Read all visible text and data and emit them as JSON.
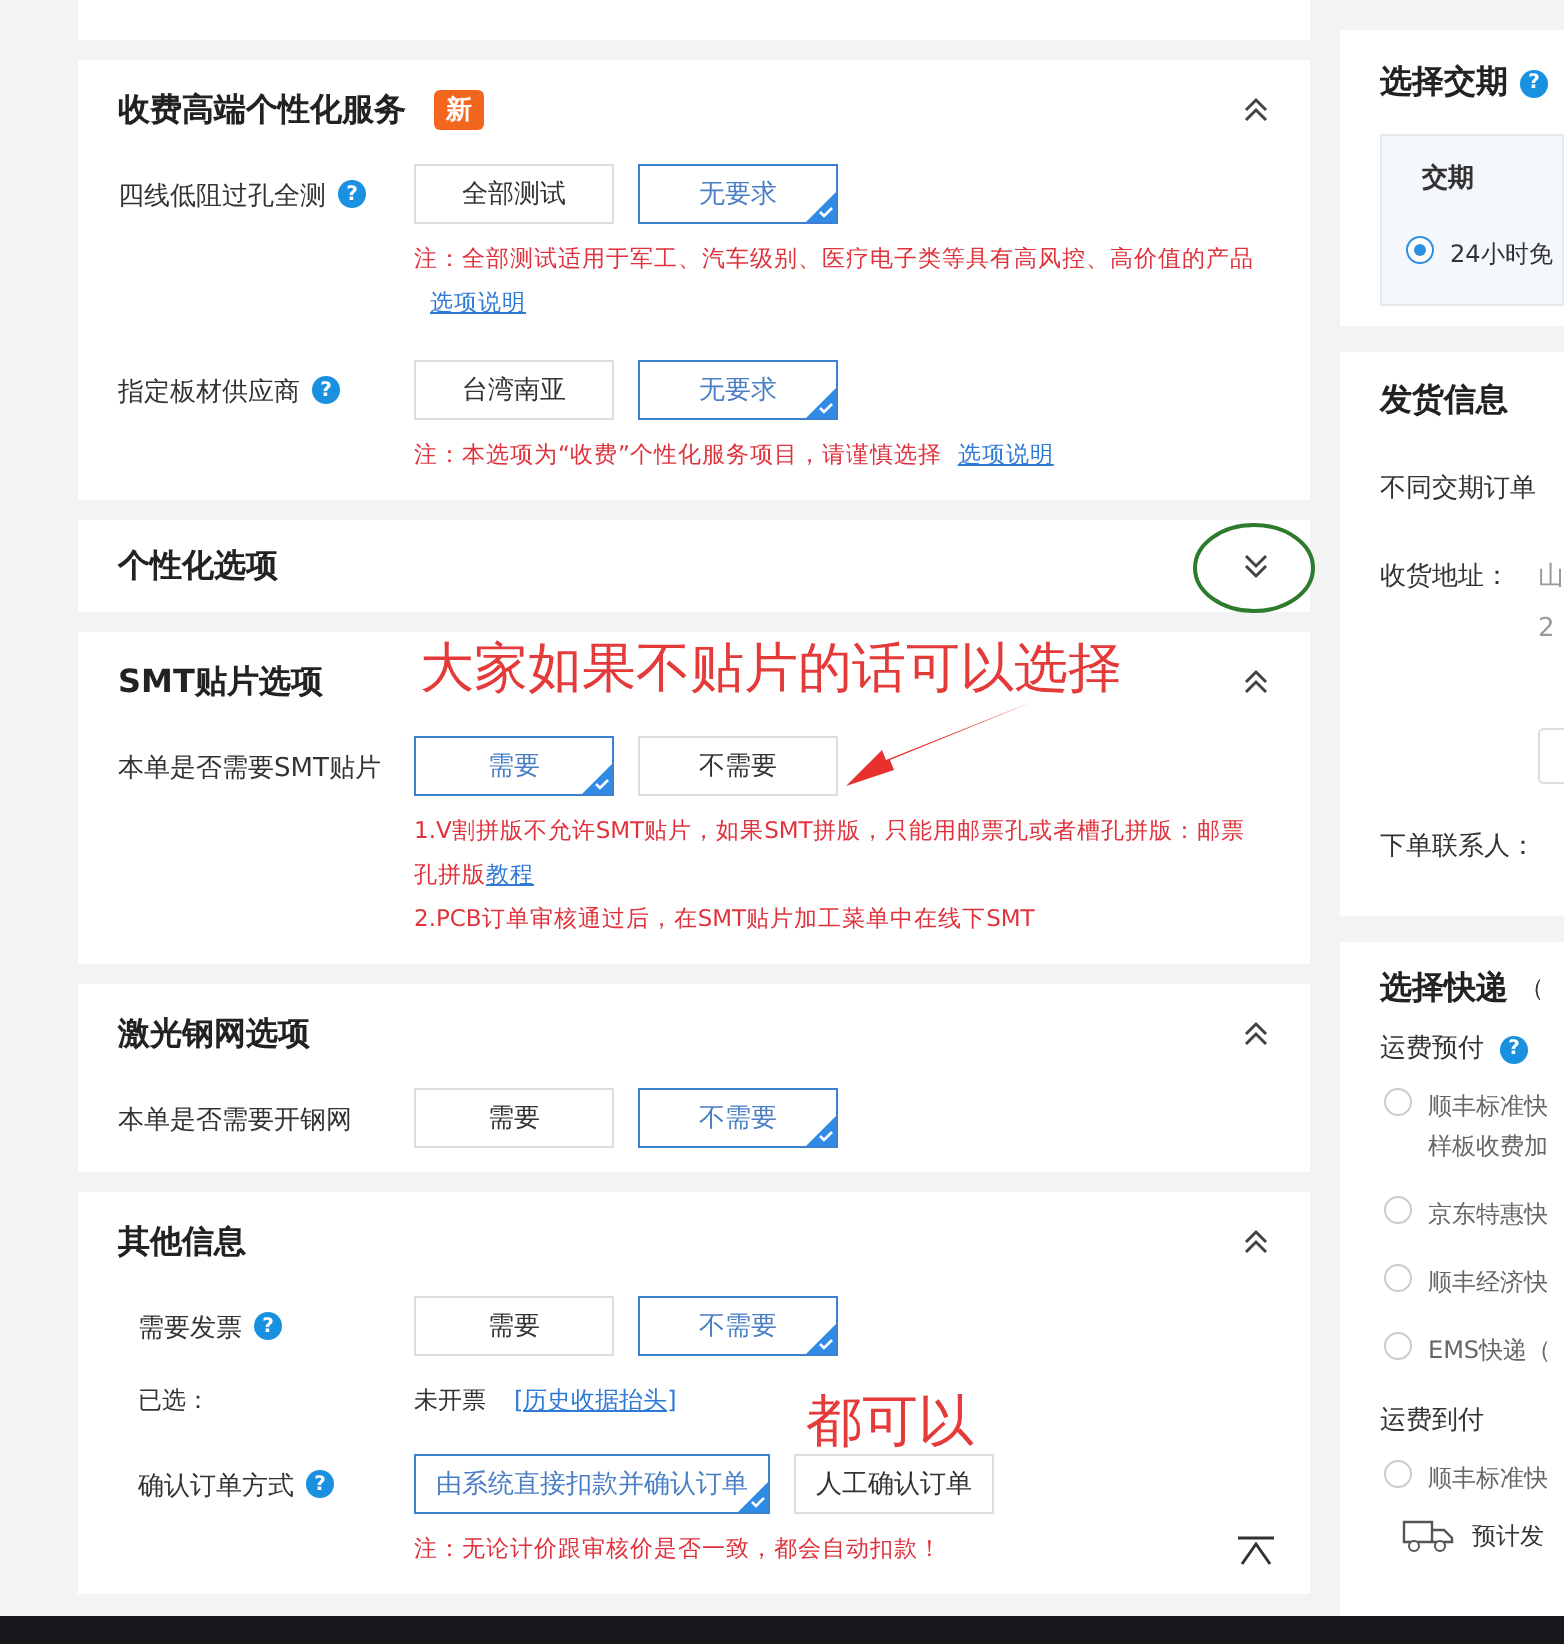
{
  "sections": [
    {
      "title": "收费高端个性化服务",
      "badge": "新",
      "expanded": true,
      "rows": [
        {
          "kind": "options",
          "label": "四线低阻过孔全测",
          "help": "?",
          "options": [
            {
              "label": "全部测试",
              "selected": false
            },
            {
              "label": "无要求",
              "selected": true
            }
          ],
          "notes": [
            {
              "text": "注：全部测试适用于军工、汽车级别、医疗电子类等具有高风控、高价值的产品",
              "link": "选项说明"
            }
          ]
        },
        {
          "kind": "options",
          "label": "指定板材供应商",
          "help": "?",
          "options": [
            {
              "label": "台湾南亚",
              "selected": false
            },
            {
              "label": "无要求",
              "selected": true
            }
          ],
          "notes": [
            {
              "text": "注：本选项为“收费”个性化服务项目，请谨慎选择",
              "link": "选项说明"
            }
          ]
        }
      ]
    },
    {
      "title": "个性化选项",
      "expanded": false
    },
    {
      "title": "SMT贴片选项",
      "expanded": true,
      "rows": [
        {
          "kind": "options",
          "label": "本单是否需要SMT贴片",
          "options": [
            {
              "label": "需要",
              "selected": true
            },
            {
              "label": "不需要",
              "selected": false
            }
          ],
          "notes": [
            {
              "text": "1.V割拼版不允许SMT贴片，如果SMT拼版，只能用邮票孔或者槽孔拼版：邮票孔拼版",
              "link": "教程"
            },
            {
              "text": "2.PCB订单审核通过后，在SMT贴片加工菜单中在线下SMT"
            }
          ]
        }
      ]
    },
    {
      "title": "激光钢网选项",
      "expanded": true,
      "rows": [
        {
          "kind": "options",
          "label": "本单是否需要开钢网",
          "options": [
            {
              "label": "需要",
              "selected": false
            },
            {
              "label": "不需要",
              "selected": true
            }
          ],
          "notes": []
        }
      ]
    },
    {
      "title": "其他信息",
      "expanded": true,
      "rows": [
        {
          "kind": "options",
          "label": "需要发票",
          "help": "?",
          "options": [
            {
              "label": "需要",
              "selected": false
            },
            {
              "label": "不需要",
              "selected": true
            }
          ],
          "notes": []
        },
        {
          "kind": "info",
          "label": "已选：",
          "value": "未开票",
          "link": "[历史收据抬头]"
        },
        {
          "kind": "options",
          "label": "确认订单方式",
          "help": "?",
          "options": [
            {
              "label": "由系统直接扣款并确认订单",
              "selected": true
            },
            {
              "label": "人工确认订单",
              "selected": false
            }
          ],
          "notes": [
            {
              "text": "注：无论计价跟审核价是否一致，都会自动扣款！"
            }
          ]
        }
      ]
    }
  ],
  "right": {
    "delivery_time": {
      "title": "选择交期",
      "help": "?",
      "header": "交期",
      "options": [
        {
          "label": "24小时免",
          "selected": true
        }
      ]
    },
    "shipping_info": {
      "title": "发货信息",
      "note": "不同交期订单",
      "address_label": "收货地址：",
      "address_lines": [
        "山",
        "2"
      ],
      "contact_label": "下单联系人："
    },
    "courier": {
      "title": "选择快递",
      "title_suffix": "（",
      "groups": [
        {
          "label": "运费预付",
          "help": "?",
          "options": [
            {
              "label": "顺丰标准快",
              "sub": "样板收费加",
              "selected": false
            },
            {
              "label": "京东特惠快",
              "selected": false
            },
            {
              "label": "顺丰经济快",
              "selected": false
            },
            {
              "label": "EMS快递（",
              "selected": false
            }
          ]
        },
        {
          "label": "运费到付",
          "options": [
            {
              "label": "顺丰标准快",
              "selected": false
            }
          ]
        }
      ],
      "estimate": "预计发"
    }
  },
  "annotations": [
    {
      "kind": "text",
      "text": "大家如果不贴片的话可以选择"
    },
    {
      "kind": "arrow"
    },
    {
      "kind": "text",
      "text": "都可以"
    },
    {
      "kind": "circle"
    }
  ]
}
